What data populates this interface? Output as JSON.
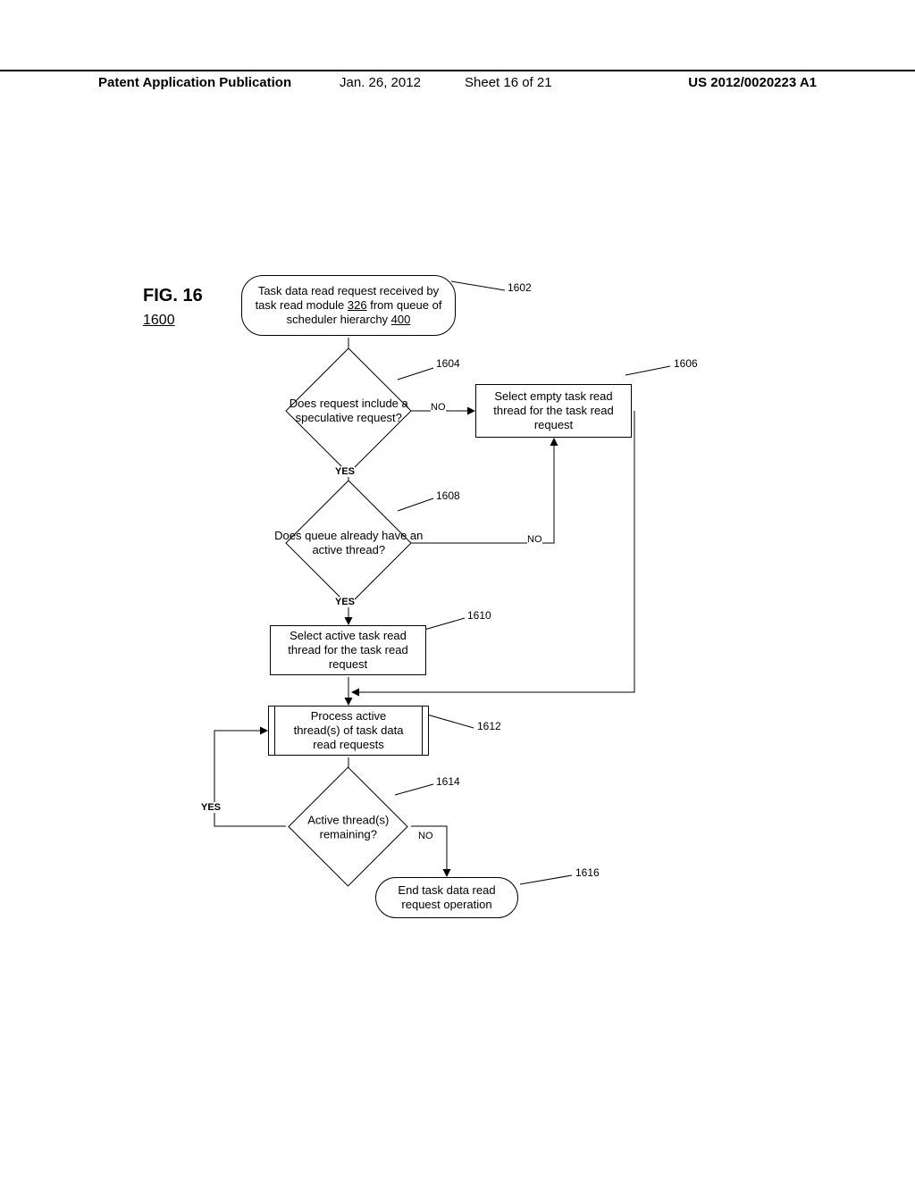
{
  "header": {
    "left": "Patent Application Publication",
    "date": "Jan. 26, 2012",
    "sheet": "Sheet 16 of 21",
    "pubno": "US 2012/0020223 A1"
  },
  "figure": {
    "title": "FIG. 16",
    "number": "1600"
  },
  "nodes": {
    "n1602": {
      "ref": "1602",
      "line1": "Task data read request received by",
      "line2_pre": "task read module ",
      "line2_u": "326",
      "line2_post": " from queue of",
      "line3_pre": "scheduler hierarchy ",
      "line3_u": "400"
    },
    "n1604": {
      "ref": "1604",
      "text": "Does request include a speculative request?"
    },
    "n1606": {
      "ref": "1606",
      "text": "Select empty task read thread for the task read request"
    },
    "n1608": {
      "ref": "1608",
      "text": "Does queue already have an active thread?"
    },
    "n1610": {
      "ref": "1610",
      "text": "Select active task read thread for the task read request"
    },
    "n1612": {
      "ref": "1612",
      "text": "Process active thread(s) of task data read requests"
    },
    "n1614": {
      "ref": "1614",
      "text": "Active thread(s) remaining?"
    },
    "n1616": {
      "ref": "1616",
      "text": "End task data read request operation"
    }
  },
  "edges": {
    "yes": "YES",
    "no": "NO"
  }
}
